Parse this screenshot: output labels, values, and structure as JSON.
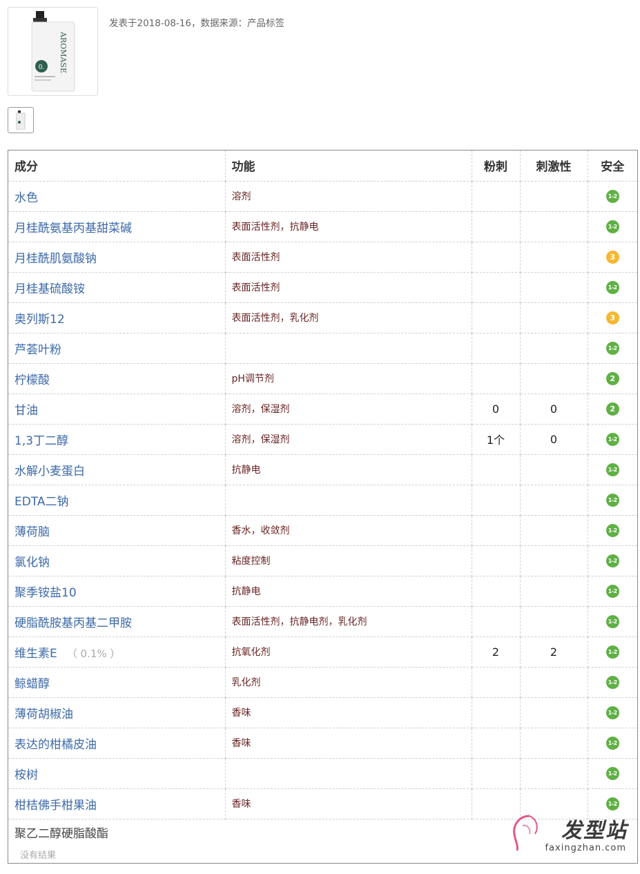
{
  "product": {
    "bottle_brand": "AROMASE",
    "meta": "发表于2018-08-16，数据来源：产品标签"
  },
  "table": {
    "headers": {
      "name": "成分",
      "function": "功能",
      "acne": "粉刺",
      "irritation": "刺激性",
      "safety": "安全"
    },
    "rows": [
      {
        "name": "水色",
        "pct": "",
        "function": "溶剂",
        "acne": "",
        "irritation": "",
        "safety": "1-2"
      },
      {
        "name": "月桂酰氨基丙基甜菜碱",
        "pct": "",
        "function": "表面活性剂，抗静电",
        "acne": "",
        "irritation": "",
        "safety": "1-2"
      },
      {
        "name": "月桂酰肌氨酸钠",
        "pct": "",
        "function": "表面活性剂",
        "acne": "",
        "irritation": "",
        "safety": "3"
      },
      {
        "name": "月桂基硫酸铵",
        "pct": "",
        "function": "表面活性剂",
        "acne": "",
        "irritation": "",
        "safety": "1-2"
      },
      {
        "name": "奥列斯12",
        "pct": "",
        "function": "表面活性剂，乳化剂",
        "acne": "",
        "irritation": "",
        "safety": "3"
      },
      {
        "name": "芦荟叶粉",
        "pct": "",
        "function": "",
        "acne": "",
        "irritation": "",
        "safety": "1-2"
      },
      {
        "name": "柠檬酸",
        "pct": "",
        "function": "pH调节剂",
        "acne": "",
        "irritation": "",
        "safety": "2"
      },
      {
        "name": "甘油",
        "pct": "",
        "function": "溶剂，保湿剂",
        "acne": "0",
        "irritation": "0",
        "safety": "2"
      },
      {
        "name": "1,3丁二醇",
        "pct": "",
        "function": "溶剂，保湿剂",
        "acne": "1个",
        "irritation": "0",
        "safety": "1-2"
      },
      {
        "name": "水解小麦蛋白",
        "pct": "",
        "function": "抗静电",
        "acne": "",
        "irritation": "",
        "safety": "1-2"
      },
      {
        "name": "EDTA二钠",
        "pct": "",
        "function": "",
        "acne": "",
        "irritation": "",
        "safety": "1-2"
      },
      {
        "name": "薄荷脑",
        "pct": "",
        "function": "香水，收敛剂",
        "acne": "",
        "irritation": "",
        "safety": "1-2"
      },
      {
        "name": "氯化钠",
        "pct": "",
        "function": "粘度控制",
        "acne": "",
        "irritation": "",
        "safety": "1-2"
      },
      {
        "name": "聚季铵盐10",
        "pct": "",
        "function": "抗静电",
        "acne": "",
        "irritation": "",
        "safety": "1-2"
      },
      {
        "name": "硬脂酰胺基丙基二甲胺",
        "pct": "",
        "function": "表面活性剂，抗静电剂，乳化剂",
        "acne": "",
        "irritation": "",
        "safety": "1-2"
      },
      {
        "name": "维生素E",
        "pct": "（ 0.1% ）",
        "function": "抗氧化剂",
        "acne": "2",
        "irritation": "2",
        "safety": "1-2"
      },
      {
        "name": "鲸蜡醇",
        "pct": "",
        "function": "乳化剂",
        "acne": "",
        "irritation": "",
        "safety": "1-2"
      },
      {
        "name": "薄荷胡椒油",
        "pct": "",
        "function": "香味",
        "acne": "",
        "irritation": "",
        "safety": "1-2"
      },
      {
        "name": "表达的柑橘皮油",
        "pct": "",
        "function": "香味",
        "acne": "",
        "irritation": "",
        "safety": "1-2"
      },
      {
        "name": "桉树",
        "pct": "",
        "function": "",
        "acne": "",
        "irritation": "",
        "safety": "1-2"
      },
      {
        "name": "柑桔佛手柑果油",
        "pct": "",
        "function": "香味",
        "acne": "",
        "irritation": "",
        "safety": "1-2"
      }
    ],
    "unmatched": {
      "name": "聚乙二醇硬脂酸酯",
      "note": "没有结果"
    }
  },
  "colors": {
    "safe_green": "#5fb045",
    "moderate_orange": "#f5b731",
    "name_link": "#3d6aa8",
    "function_text": "#6a2424"
  },
  "watermark": {
    "logo": "发型站",
    "url": "faxingzhan.com"
  }
}
